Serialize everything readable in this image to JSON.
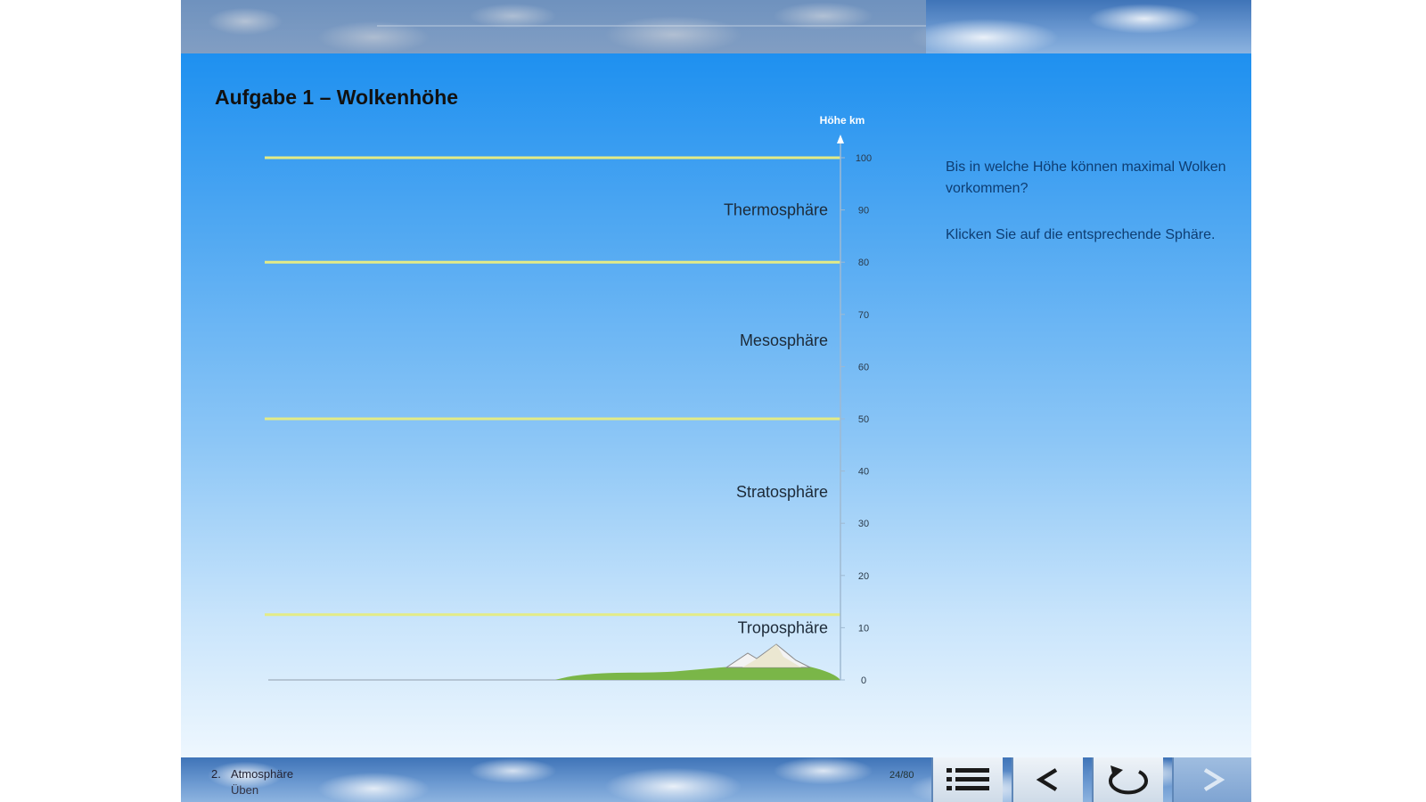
{
  "task": {
    "title": "Aufgabe 1 – Wolkenhöhe",
    "question": "Bis in welche Höhe können maximal Wolken vorkommen?",
    "instruction": "Klicken Sie auf die entsprechende Sphäre."
  },
  "chart_data": {
    "type": "diagram",
    "axis_label": "Höhe km",
    "axis_ticks": [
      0,
      10,
      20,
      30,
      40,
      50,
      60,
      70,
      80,
      90,
      100
    ],
    "ylim": [
      0,
      100
    ],
    "layer_boundaries_km": [
      12.5,
      50,
      80,
      100
    ],
    "spheres": [
      {
        "name": "Troposphäre",
        "label_km": 10
      },
      {
        "name": "Stratosphäre",
        "label_km": 36
      },
      {
        "name": "Mesosphäre",
        "label_km": 65
      },
      {
        "name": "Thermosphäre",
        "label_km": 90
      }
    ],
    "colors": {
      "boundary_line": "#e3eb86",
      "axis": "#9fb9d1",
      "land": "#7ab648"
    }
  },
  "footer": {
    "chapter_number": "2.",
    "chapter_title": "Atmosphäre",
    "section": "Üben",
    "page_counter": "24/80"
  },
  "nav": {
    "menu": "list-icon",
    "back": "chevron-left-icon",
    "reload": "refresh-icon",
    "next": "chevron-right-icon"
  }
}
